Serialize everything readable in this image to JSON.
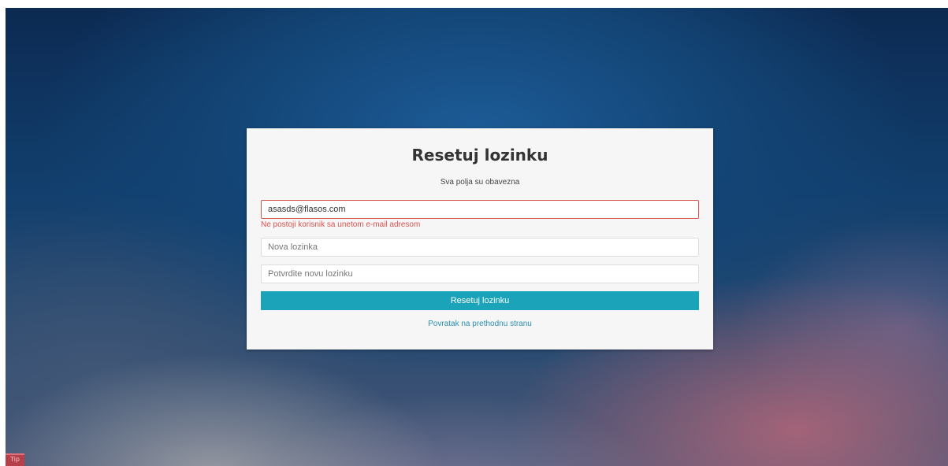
{
  "reset_form": {
    "title": "Resetuj lozinku",
    "subtitle": "Sva polja su obavezna",
    "email": {
      "value": "asasds@flasos.com",
      "error": "Ne postoji korisnik sa unetom e-mail adresom"
    },
    "new_password": {
      "placeholder": "Nova lozinka"
    },
    "confirm_password": {
      "placeholder": "Potvrdite novu lozinku"
    },
    "submit_label": "Resetuj lozinku",
    "back_link": "Povratak na prethodnu stranu"
  },
  "colors": {
    "accent": "#1aa3b9",
    "error": "#d9534f",
    "link": "#2a8fb0"
  },
  "corner_widget": {
    "icon": "app-badge-icon",
    "text": "Tip"
  }
}
